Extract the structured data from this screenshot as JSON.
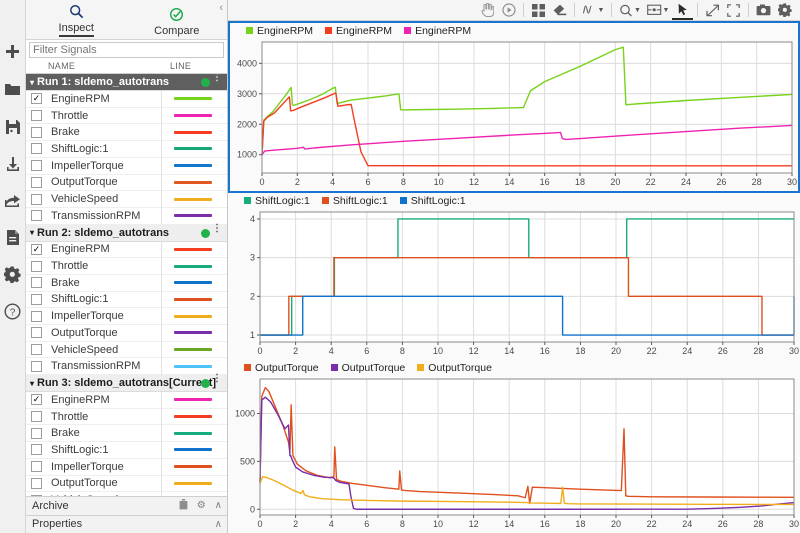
{
  "rail": {
    "items": [
      {
        "name": "add-icon",
        "title": "Add"
      },
      {
        "name": "folder-open-icon",
        "title": "Open"
      },
      {
        "name": "save-icon",
        "title": "Save"
      },
      {
        "name": "import-icon",
        "title": "Import"
      },
      {
        "name": "share-icon",
        "title": "Share"
      },
      {
        "name": "report-icon",
        "title": "Report"
      },
      {
        "name": "gear-icon",
        "title": "Settings"
      },
      {
        "name": "help-icon",
        "title": "Help"
      }
    ]
  },
  "panel": {
    "tabs": [
      {
        "label": "Inspect",
        "icon": "search-icon",
        "active": true
      },
      {
        "label": "Compare",
        "icon": "check-circle-icon",
        "active": false
      }
    ],
    "collapse_glyph": "‹",
    "filter": {
      "placeholder": "Filter Signals",
      "value": ""
    },
    "columns": {
      "name": "NAME",
      "line": "LINE"
    },
    "caret_glyph": "▾",
    "menu_glyph": "⋮",
    "check_glyph": "✓",
    "archive": {
      "label": "Archive",
      "trash_glyph": "🗑",
      "gear_glyph": "⚙",
      "chevron_glyph": "∧"
    },
    "properties": {
      "label": "Properties",
      "chevron_glyph": "∧"
    },
    "runs": [
      {
        "title": "Run 1: sldemo_autotrans",
        "selected": true,
        "status_color": "#21b14b",
        "signals": [
          {
            "name": "EngineRPM",
            "checked": true,
            "color": "#77d219"
          },
          {
            "name": "Throttle",
            "checked": false,
            "color": "#ef23b1"
          },
          {
            "name": "Brake",
            "checked": false,
            "color": "#f93a20"
          },
          {
            "name": "ShiftLogic:1",
            "checked": false,
            "color": "#14a877"
          },
          {
            "name": "ImpellerTorque",
            "checked": false,
            "color": "#1278cc"
          },
          {
            "name": "OutputTorque",
            "checked": false,
            "color": "#e25822"
          },
          {
            "name": "VehicleSpeed",
            "checked": false,
            "color": "#f0ad1e"
          },
          {
            "name": "TransmissionRPM",
            "checked": false,
            "color": "#7b2fa8"
          }
        ]
      },
      {
        "title": "Run 2: sldemo_autotrans",
        "selected": false,
        "status_color": "#21b14b",
        "signals": [
          {
            "name": "EngineRPM",
            "checked": true,
            "color": "#f43d20"
          },
          {
            "name": "Throttle",
            "checked": false,
            "color": "#16ac7d"
          },
          {
            "name": "Brake",
            "checked": false,
            "color": "#0f73cc"
          },
          {
            "name": "ShiftLogic:1",
            "checked": false,
            "color": "#e0501f"
          },
          {
            "name": "ImpellerTorque",
            "checked": false,
            "color": "#f0ae1c"
          },
          {
            "name": "OutputTorque",
            "checked": false,
            "color": "#7a2da8"
          },
          {
            "name": "VehicleSpeed",
            "checked": false,
            "color": "#6aa524"
          },
          {
            "name": "TransmissionRPM",
            "checked": false,
            "color": "#4fc3f7"
          }
        ]
      },
      {
        "title": "Run 3: sldemo_autotrans[Current]",
        "selected": false,
        "status_color": "#21b14b",
        "signals": [
          {
            "name": "EngineRPM",
            "checked": true,
            "color": "#ef23b1"
          },
          {
            "name": "Throttle",
            "checked": false,
            "color": "#f43d20"
          },
          {
            "name": "Brake",
            "checked": false,
            "color": "#16ac7d"
          },
          {
            "name": "ShiftLogic:1",
            "checked": false,
            "color": "#0f73cc"
          },
          {
            "name": "ImpellerTorque",
            "checked": false,
            "color": "#e0501f"
          },
          {
            "name": "OutputTorque",
            "checked": false,
            "color": "#f0ae1c"
          },
          {
            "name": "VehicleSpeed",
            "checked": false,
            "color": "#7a2da8"
          }
        ]
      }
    ]
  },
  "toolbar": {
    "buttons": [
      {
        "name": "pan-icon",
        "label": "Pan",
        "caret": false,
        "selected": false
      },
      {
        "name": "run-icon",
        "label": "Run",
        "caret": false,
        "selected": false
      },
      {
        "name": "layout-grid-icon",
        "label": "Layout",
        "caret": false,
        "selected": false
      },
      {
        "name": "eraser-icon",
        "label": "Clear",
        "caret": false,
        "selected": false
      },
      {
        "name": "signal-trace-icon",
        "label": "Trace",
        "caret": true,
        "selected": false
      },
      {
        "name": "zoom-icon",
        "label": "Zoom",
        "caret": true,
        "selected": false
      },
      {
        "name": "zoom-region-icon",
        "label": "Zoom Region",
        "caret": true,
        "selected": false
      },
      {
        "name": "cursor-arrow-icon",
        "label": "Select",
        "caret": false,
        "selected": true
      },
      {
        "name": "fit-to-view-icon",
        "label": "Fit to View",
        "caret": false,
        "selected": false
      },
      {
        "name": "expand-icon",
        "label": "Expand",
        "caret": false,
        "selected": false
      },
      {
        "name": "snapshot-icon",
        "label": "Snapshot",
        "caret": false,
        "selected": false
      },
      {
        "name": "settings-gear-icon",
        "label": "Settings",
        "caret": false,
        "selected": false
      }
    ]
  },
  "chart_data": [
    {
      "type": "line",
      "name": "engine-rpm-plot",
      "focused": true,
      "title": "",
      "xlabel": "",
      "ylabel": "",
      "xlim": [
        0,
        30
      ],
      "ylim": [
        400,
        4700
      ],
      "xticks": [
        0,
        2,
        4,
        6,
        8,
        10,
        12,
        14,
        16,
        18,
        20,
        22,
        24,
        26,
        28,
        30
      ],
      "yticks": [
        1000,
        2000,
        3000,
        4000
      ],
      "grid": true,
      "legend_position": "top-left",
      "series": [
        {
          "name": "EngineRPM",
          "color": "#77d219",
          "run": "Run 1",
          "x": [
            0,
            0.1,
            0.3,
            0.6,
            1.0,
            1.4,
            1.65,
            1.72,
            1.8,
            2.2,
            2.8,
            3.4,
            4.0,
            4.15,
            4.25,
            4.4,
            5.0,
            6.0,
            7.0,
            7.75,
            7.85,
            8.0,
            9.0,
            11.0,
            13.0,
            14.6,
            14.8,
            15.2,
            16.0,
            18.0,
            20.0,
            20.45,
            20.6,
            21.0,
            24.0,
            27.0,
            30.0
          ],
          "y": [
            980,
            2130,
            2250,
            2400,
            2700,
            3000,
            3210,
            2640,
            2620,
            2700,
            2830,
            2980,
            3180,
            3215,
            2680,
            2700,
            2790,
            2860,
            2930,
            3000,
            2480,
            2470,
            2480,
            2495,
            2520,
            2545,
            2550,
            3100,
            3400,
            3900,
            4450,
            4530,
            2640,
            2660,
            2780,
            2880,
            2980
          ]
        },
        {
          "name": "EngineRPM",
          "color": "#f43d20",
          "run": "Run 2",
          "x": [
            0,
            0.1,
            0.3,
            0.7,
            1.2,
            1.55,
            1.62,
            1.75,
            2.2,
            2.9,
            3.6,
            4.1,
            4.18,
            4.3,
            4.8,
            5.05,
            5.2,
            5.6,
            6.0,
            10.0,
            16.0,
            22.0,
            30.0
          ],
          "y": [
            980,
            2100,
            2230,
            2370,
            2680,
            2900,
            2440,
            2450,
            2560,
            2720,
            2880,
            3010,
            3020,
            2590,
            2640,
            2650,
            2200,
            1100,
            640,
            638,
            637,
            636,
            635
          ]
        },
        {
          "name": "EngineRPM",
          "color": "#ef23b1",
          "run": "Run 3",
          "x": [
            0,
            0.15,
            0.5,
            1.2,
            2.0,
            2.35,
            2.42,
            2.55,
            3.0,
            5.0,
            8.0,
            11.0,
            14.0,
            16.5,
            16.9,
            17.0,
            17.2,
            18.0,
            21.0,
            24.0,
            27.0,
            30.0
          ],
          "y": [
            1000,
            1120,
            1140,
            1175,
            1210,
            1245,
            1190,
            1195,
            1225,
            1320,
            1440,
            1540,
            1640,
            1715,
            1730,
            1530,
            1500,
            1530,
            1650,
            1760,
            1870,
            1960
          ]
        }
      ]
    },
    {
      "type": "line",
      "name": "shift-logic-plot",
      "focused": false,
      "title": "",
      "xlabel": "",
      "ylabel": "",
      "xlim": [
        0,
        30
      ],
      "ylim": [
        0.82,
        4.18
      ],
      "xticks": [
        0,
        2,
        4,
        6,
        8,
        10,
        12,
        14,
        16,
        18,
        20,
        22,
        24,
        26,
        28,
        30
      ],
      "yticks": [
        1,
        2,
        3,
        4
      ],
      "grid": true,
      "step": true,
      "legend_position": "top-left",
      "series": [
        {
          "name": "ShiftLogic:1",
          "color": "#16ac7d",
          "run": "Run 1",
          "x": [
            0,
            1.78,
            4.18,
            7.75,
            15.1,
            20.6,
            30
          ],
          "y": [
            1,
            2,
            3,
            4,
            3,
            4,
            4
          ]
        },
        {
          "name": "ShiftLogic:1",
          "color": "#e0501f",
          "run": "Run 2",
          "x": [
            0,
            1.62,
            4.15,
            20.7,
            28.2,
            30
          ],
          "y": [
            1,
            2,
            3,
            2,
            1,
            1
          ]
        },
        {
          "name": "ShiftLogic:1",
          "color": "#0f73cc",
          "run": "Run 3",
          "x": [
            0,
            2.4,
            17.0,
            30
          ],
          "y": [
            1,
            2,
            1,
            2
          ]
        }
      ]
    },
    {
      "type": "line",
      "name": "output-torque-plot",
      "focused": false,
      "title": "",
      "xlabel": "",
      "ylabel": "",
      "xlim": [
        0,
        30
      ],
      "ylim": [
        -60,
        1360
      ],
      "xticks": [
        0,
        2,
        4,
        6,
        8,
        10,
        12,
        14,
        16,
        18,
        20,
        22,
        24,
        26,
        28,
        30
      ],
      "yticks": [
        0,
        500,
        1000
      ],
      "grid": true,
      "legend_position": "top-left",
      "series": [
        {
          "name": "OutputTorque",
          "color": "#e0501f",
          "run": "Run 2",
          "x": [
            0,
            0.1,
            0.3,
            0.5,
            0.9,
            1.3,
            1.6,
            1.68,
            1.75,
            1.85,
            2.1,
            2.6,
            3.2,
            3.9,
            4.15,
            4.2,
            4.3,
            4.6,
            5.2,
            6.0,
            7.0,
            7.8,
            7.85,
            7.95,
            8.2,
            9.0,
            11.0,
            13.0,
            14.5,
            14.9,
            15.05,
            15.15,
            15.3,
            16.0,
            18.0,
            20.3,
            20.45,
            20.55,
            20.7,
            22.0,
            25.0,
            28.0,
            30.0
          ],
          "y": [
            280,
            1180,
            1270,
            1230,
            1050,
            870,
            700,
            590,
            1090,
            560,
            470,
            400,
            355,
            330,
            340,
            650,
            310,
            290,
            270,
            250,
            225,
            210,
            400,
            200,
            195,
            185,
            170,
            155,
            140,
            120,
            240,
            60,
            230,
            225,
            210,
            195,
            840,
            140,
            135,
            130,
            128,
            126,
            125
          ]
        },
        {
          "name": "OutputTorque",
          "color": "#7a2da8",
          "run": "Run 3",
          "x": [
            0,
            0.1,
            0.3,
            0.6,
            1.0,
            1.4,
            1.6,
            1.68,
            1.72,
            1.8,
            2.0,
            2.4,
            3.0,
            3.6,
            4.1,
            4.18,
            4.25,
            4.5,
            5.0,
            5.1,
            5.25,
            5.4,
            6.0,
            10.0,
            16.0,
            20.0,
            24.0,
            25.5,
            27.0,
            28.2,
            29.0,
            30.0
          ],
          "y": [
            285,
            1140,
            1170,
            1120,
            990,
            840,
            880,
            560,
            560,
            520,
            440,
            390,
            355,
            335,
            330,
            320,
            300,
            280,
            265,
            140,
            10,
            0,
            0,
            0,
            0,
            0,
            1,
            8,
            20,
            35,
            52,
            70
          ]
        },
        {
          "name": "OutputTorque",
          "color": "#f0ae1c",
          "run": "Run 1",
          "x": [
            0,
            0.15,
            0.4,
            0.8,
            1.3,
            1.9,
            2.3,
            2.42,
            2.5,
            2.8,
            3.5,
            4.5,
            6.0,
            8.0,
            11.0,
            14.0,
            15.0,
            15.2,
            16.5,
            16.9,
            17.0,
            17.1,
            17.3,
            18.0,
            21.0,
            25.0,
            28.0,
            30.0
          ],
          "y": [
            270,
            340,
            330,
            300,
            255,
            195,
            165,
            195,
            150,
            130,
            110,
            100,
            92,
            85,
            80,
            74,
            70,
            66,
            62,
            60,
            230,
            62,
            58,
            56,
            54,
            52,
            50,
            50
          ]
        }
      ]
    }
  ]
}
